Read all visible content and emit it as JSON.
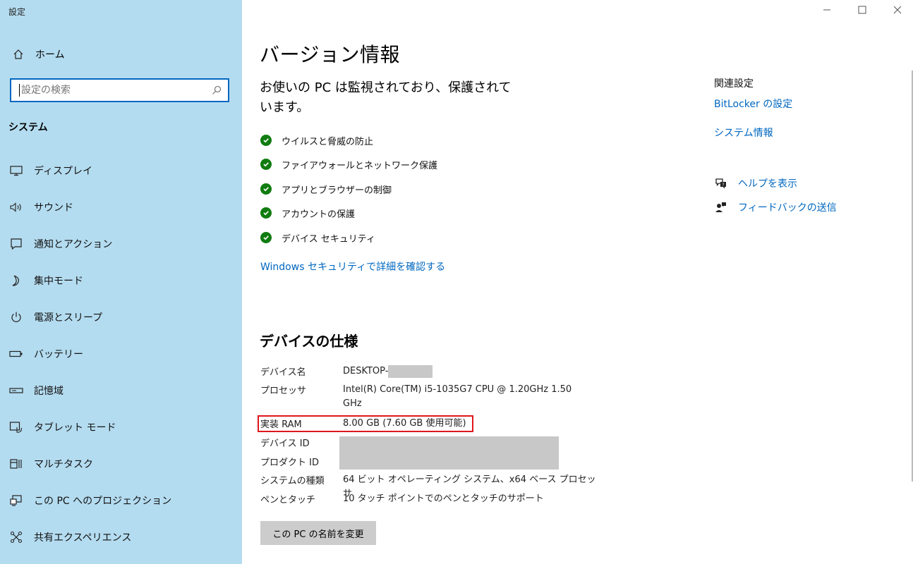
{
  "app": {
    "title": "設定"
  },
  "window": {
    "minimize": "—",
    "maximize": "☐",
    "close": "✕"
  },
  "sidebar": {
    "home_label": "ホーム",
    "search": {
      "placeholder": "設定の検索"
    },
    "section_label": "システム",
    "items": [
      {
        "label": "ディスプレイ",
        "icon": "display-icon"
      },
      {
        "label": "サウンド",
        "icon": "sound-icon"
      },
      {
        "label": "通知とアクション",
        "icon": "notification-icon"
      },
      {
        "label": "集中モード",
        "icon": "moon-icon"
      },
      {
        "label": "電源とスリープ",
        "icon": "power-icon"
      },
      {
        "label": "バッテリー",
        "icon": "battery-icon"
      },
      {
        "label": "記憶域",
        "icon": "storage-icon"
      },
      {
        "label": "タブレット モード",
        "icon": "tablet-icon"
      },
      {
        "label": "マルチタスク",
        "icon": "multitask-icon"
      },
      {
        "label": "この PC へのプロジェクション",
        "icon": "projection-icon"
      },
      {
        "label": "共有エクスペリエンス",
        "icon": "share-icon"
      }
    ],
    "bg_color": "#b4dcf0"
  },
  "main": {
    "title": "バージョン情報",
    "protection_message": "お使いの PC は監視されており、保護されています。",
    "checks": [
      "ウイルスと脅威の防止",
      "ファイアウォールとネットワーク保護",
      "アプリとブラウザーの制御",
      "アカウントの保護",
      "デバイス セキュリティ"
    ],
    "security_link": "Windows セキュリティで詳細を確認する",
    "specs": {
      "title": "デバイスの仕様",
      "rows": [
        {
          "key": "デバイス名",
          "value": "DESKTOP-"
        },
        {
          "key": "プロセッサ",
          "value": "Intel(R) Core(TM) i5-1035G7 CPU @ 1.20GHz   1.50 GHz"
        },
        {
          "key": "実装 RAM",
          "value": "8.00 GB (7.60 GB 使用可能)"
        },
        {
          "key": "デバイス ID",
          "value": ""
        },
        {
          "key": "プロダクト ID",
          "value": ""
        },
        {
          "key": "システムの種類",
          "value": "64 ビット オペレーティング システム、x64 ベース プロセッサ"
        },
        {
          "key": "ペンとタッチ",
          "value": "10 タッチ ポイントでのペンとタッチのサポート"
        }
      ]
    },
    "rename_button": "この PC の名前を変更"
  },
  "related": {
    "title": "関連設定",
    "bitlocker_link": "BitLocker の設定",
    "sysinfo_link": "システム情報",
    "help_label": "ヘルプを表示",
    "feedback_label": "フィードバックの送信"
  },
  "colors": {
    "accent": "#0067c0",
    "check_green": "#107c10",
    "highlight_red": "#e0161b"
  }
}
